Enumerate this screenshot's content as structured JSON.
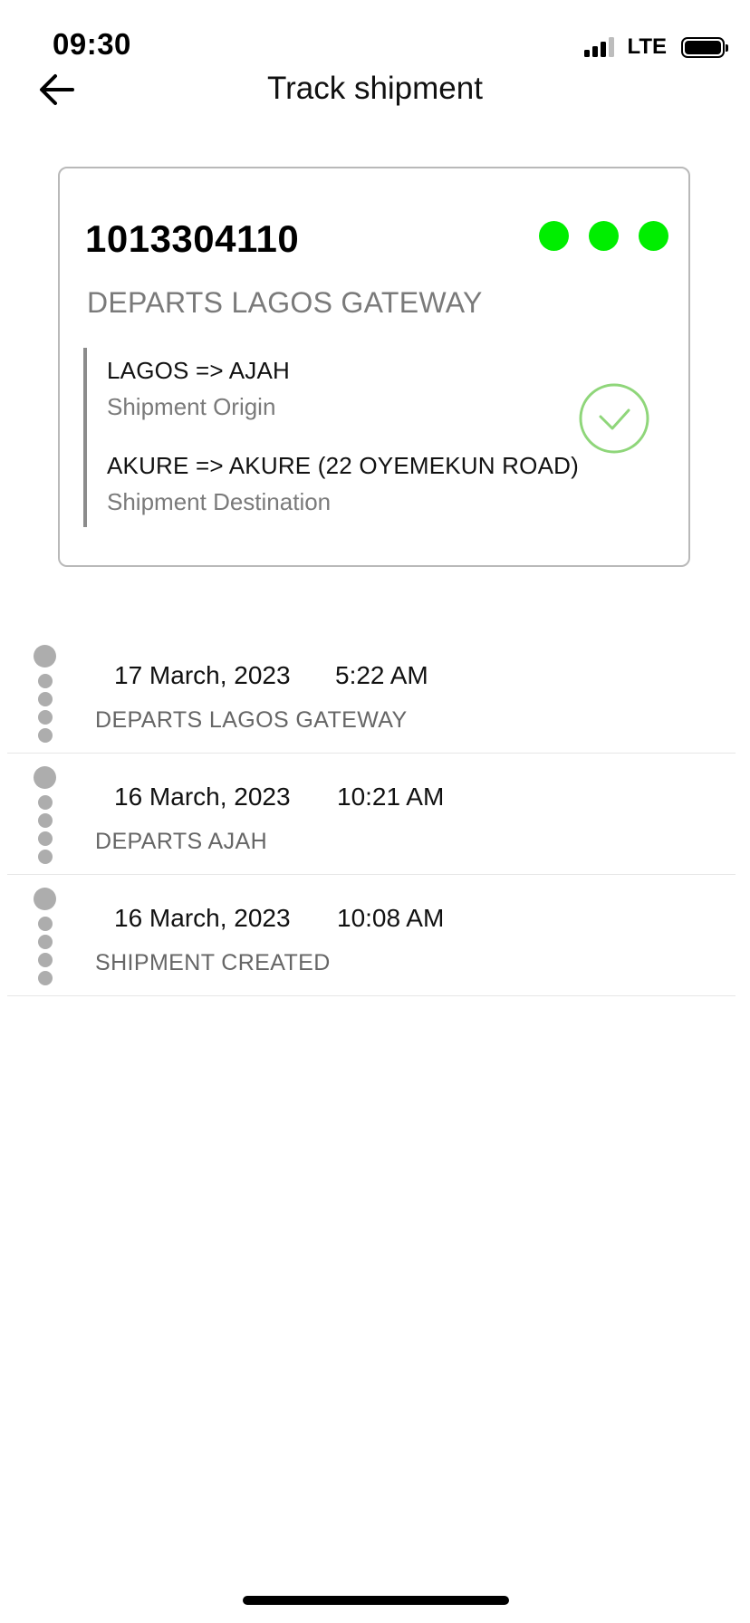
{
  "status_bar": {
    "time": "09:30",
    "network": "LTE"
  },
  "header": {
    "title": "Track shipment",
    "back_icon": "arrow-left-icon"
  },
  "shipment": {
    "tracking_number": "1013304110",
    "current_status": "DEPARTS LAGOS GATEWAY",
    "progress_color": "#00ee00",
    "progress_steps_completed": 3,
    "origin": {
      "route": "LAGOS => AJAH",
      "caption": "Shipment Origin"
    },
    "destination": {
      "route": "AKURE => AKURE (22 OYEMEKUN ROAD)",
      "caption": "Shipment Destination"
    },
    "status_icon": "check-circle-icon",
    "status_icon_color": "#8fd67a"
  },
  "timeline": [
    {
      "date": "17 March, 2023",
      "time": "5:22 AM",
      "event": "DEPARTS LAGOS GATEWAY"
    },
    {
      "date": "16 March, 2023",
      "time": "10:21 AM",
      "event": "DEPARTS AJAH"
    },
    {
      "date": "16 March, 2023",
      "time": "10:08 AM",
      "event": "SHIPMENT CREATED"
    }
  ]
}
